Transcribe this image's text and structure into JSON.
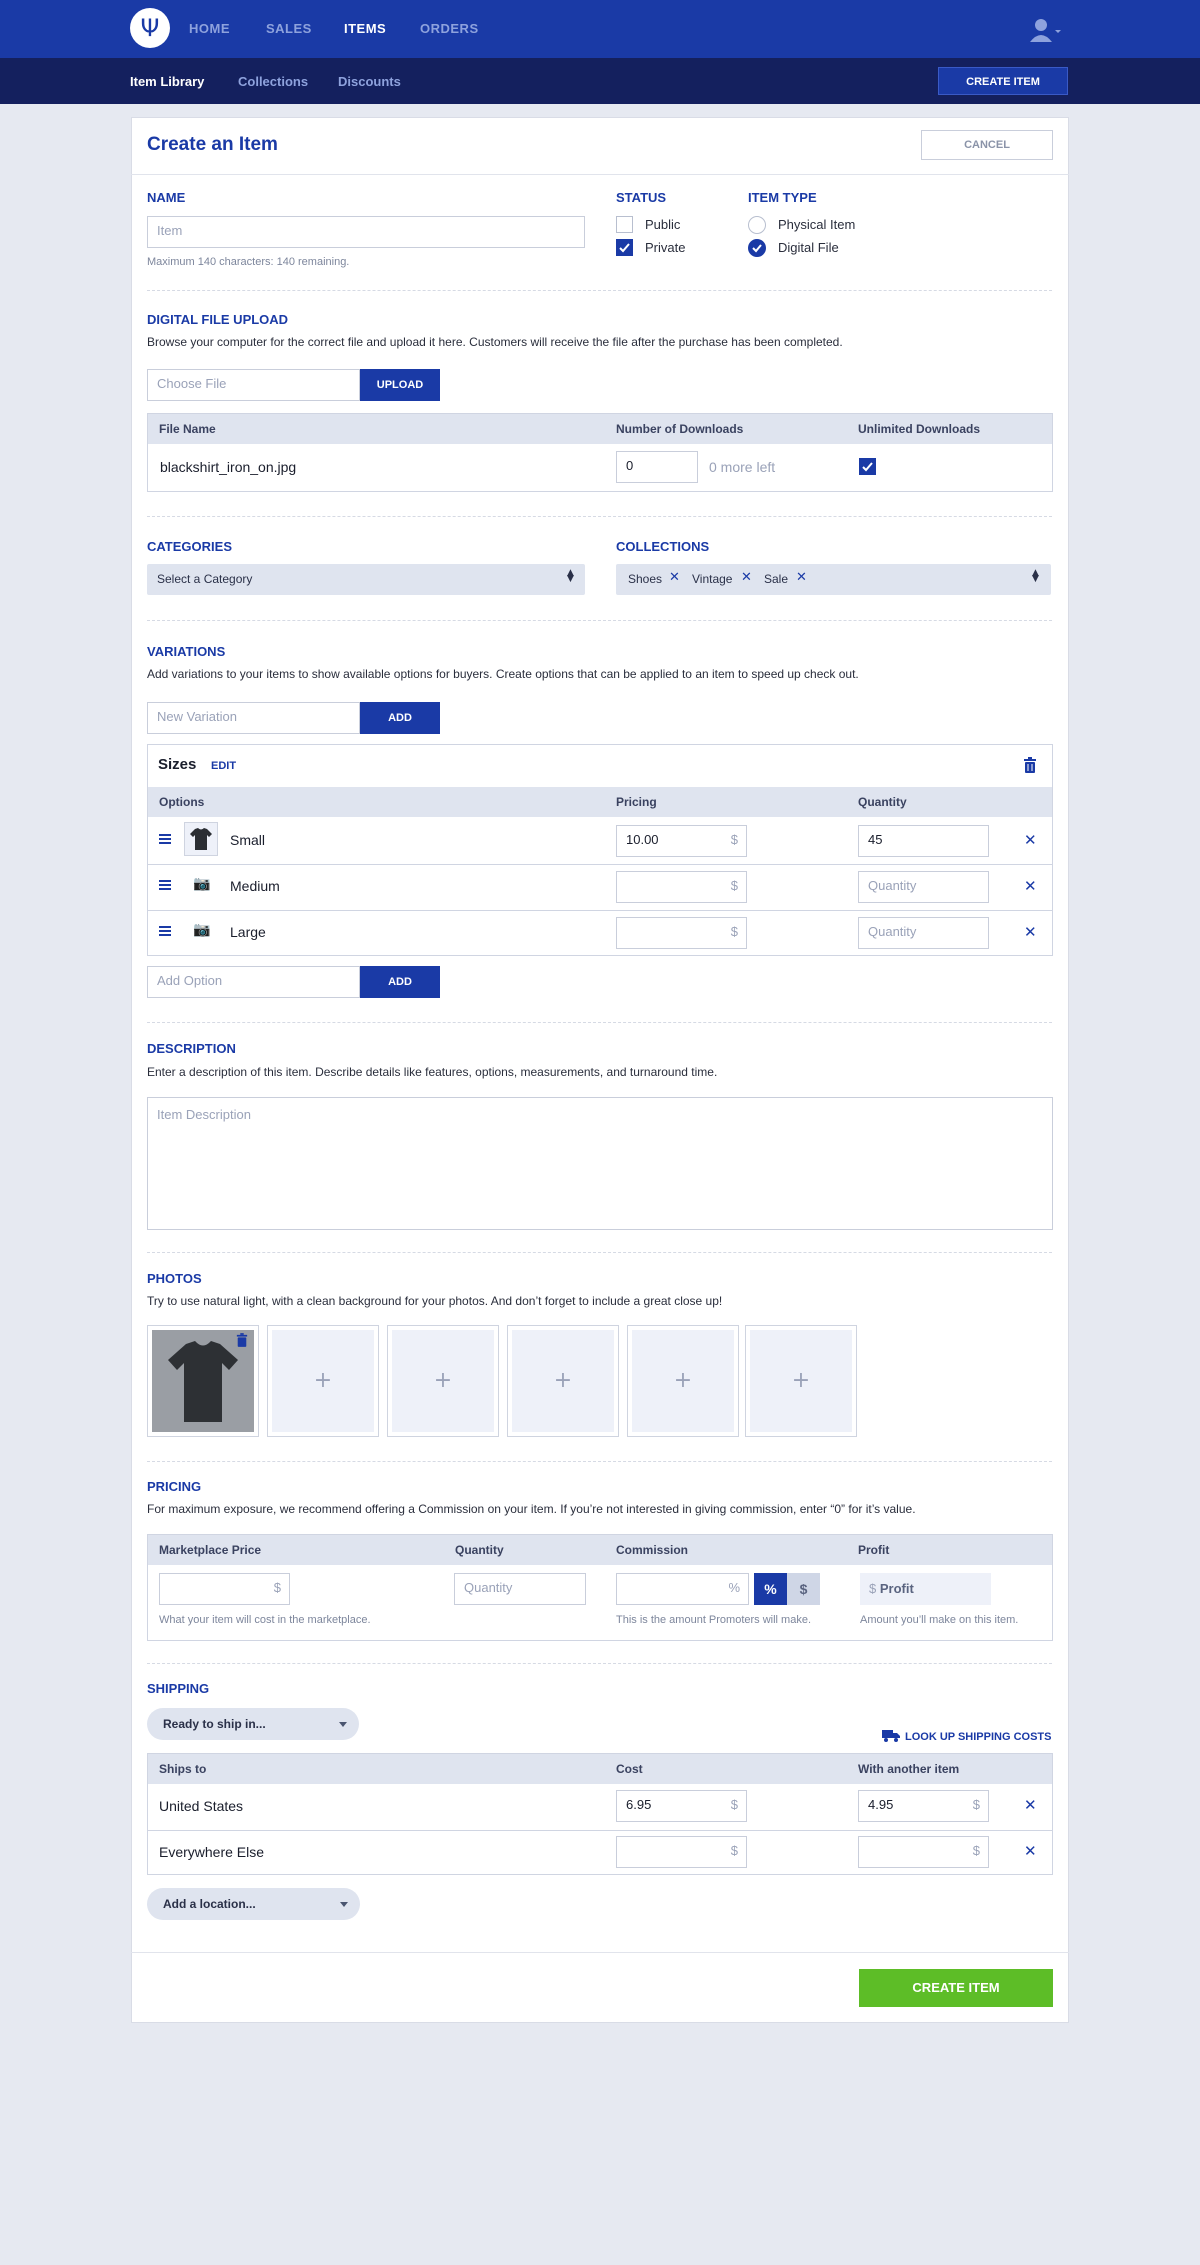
{
  "topnav": {
    "logo_glyph": "Ψ",
    "items": [
      "HOME",
      "SALES",
      "ITEMS",
      "ORDERS"
    ],
    "active": "ITEMS"
  },
  "subnav": {
    "items": [
      "Item Library",
      "Collections",
      "Discounts"
    ],
    "active": "Item Library",
    "create_button": "CREATE ITEM"
  },
  "header": {
    "title": "Create an Item",
    "cancel": "CANCEL"
  },
  "name": {
    "label": "NAME",
    "placeholder": "Item",
    "helper": "Maximum 140 characters: 140 remaining."
  },
  "status": {
    "label": "STATUS",
    "options": [
      {
        "label": "Public",
        "checked": false
      },
      {
        "label": "Private",
        "checked": true
      }
    ]
  },
  "item_type": {
    "label": "ITEM TYPE",
    "options": [
      {
        "label": "Physical Item",
        "selected": false
      },
      {
        "label": "Digital File",
        "selected": true
      }
    ]
  },
  "upload": {
    "label": "DIGITAL FILE UPLOAD",
    "description": "Browse your computer for the correct file and upload it here. Customers will receive the file after the purchase has been completed.",
    "placeholder": "Choose File",
    "button": "UPLOAD",
    "columns": [
      "File Name",
      "Number of Downloads",
      "Unlimited Downloads"
    ],
    "file": {
      "name": "blackshirt_iron_on.jpg",
      "downloads": "0",
      "remaining": "0 more left",
      "unlimited": true
    }
  },
  "categories": {
    "label": "CATEGORIES",
    "placeholder": "Select a Category"
  },
  "collections": {
    "label": "COLLECTIONS",
    "tags": [
      "Shoes",
      "Vintage",
      "Sale"
    ]
  },
  "variations": {
    "label": "VARIATIONS",
    "description": "Add variations to your items to show available options for buyers. Create options that can be applied to an item to speed up check out.",
    "placeholder": "New Variation",
    "button": "ADD",
    "group": {
      "name": "Sizes",
      "edit": "EDIT",
      "columns": [
        "Options",
        "Pricing",
        "Quantity"
      ],
      "rows": [
        {
          "name": "Small",
          "price": "10.00",
          "quantity": "45"
        },
        {
          "name": "Medium",
          "price": "",
          "quantity": ""
        },
        {
          "name": "Large",
          "price": "",
          "quantity": ""
        }
      ],
      "currency": "$",
      "quantity_placeholder": "Quantity"
    },
    "option_placeholder": "Add Option",
    "option_button": "ADD"
  },
  "description": {
    "label": "DESCRIPTION",
    "text": "Enter a description of this item. Describe details like features, options, measurements, and turnaround time.",
    "placeholder": "Item Description"
  },
  "photos": {
    "label": "PHOTOS",
    "text": "Try to use natural light, with a clean background for your photos. And don’t forget to include a great close up!",
    "add_glyph": "+"
  },
  "pricing": {
    "label": "PRICING",
    "text": "For maximum exposure, we recommend offering a Commission on your item. If you’re not interested in giving commission, enter “0” for it’s value.",
    "columns": [
      "Marketplace Price",
      "Quantity",
      "Commission",
      "Profit"
    ],
    "quantity_placeholder": "Quantity",
    "percent": "%",
    "currency": "$",
    "profit_placeholder": "Profit",
    "helpers": [
      "What your item will cost in the marketplace.",
      "This is the amount Promoters will make.",
      "Amount you’ll make on this item."
    ]
  },
  "shipping": {
    "label": "SHIPPING",
    "ready": "Ready to ship in...",
    "lookup": "LOOK UP SHIPPING COSTS",
    "columns": [
      "Ships to",
      "Cost",
      "With another item"
    ],
    "rows": [
      {
        "destination": "United States",
        "cost": "6.95",
        "additional": "4.95"
      },
      {
        "destination": "Everywhere Else",
        "cost": "",
        "additional": ""
      }
    ],
    "currency": "$",
    "add_location": "Add a location..."
  },
  "footer": {
    "create_button": "CREATE ITEM"
  },
  "colors": {
    "brand": "#1a3aa6",
    "subnav": "#14205e",
    "success": "#5dbd27"
  }
}
